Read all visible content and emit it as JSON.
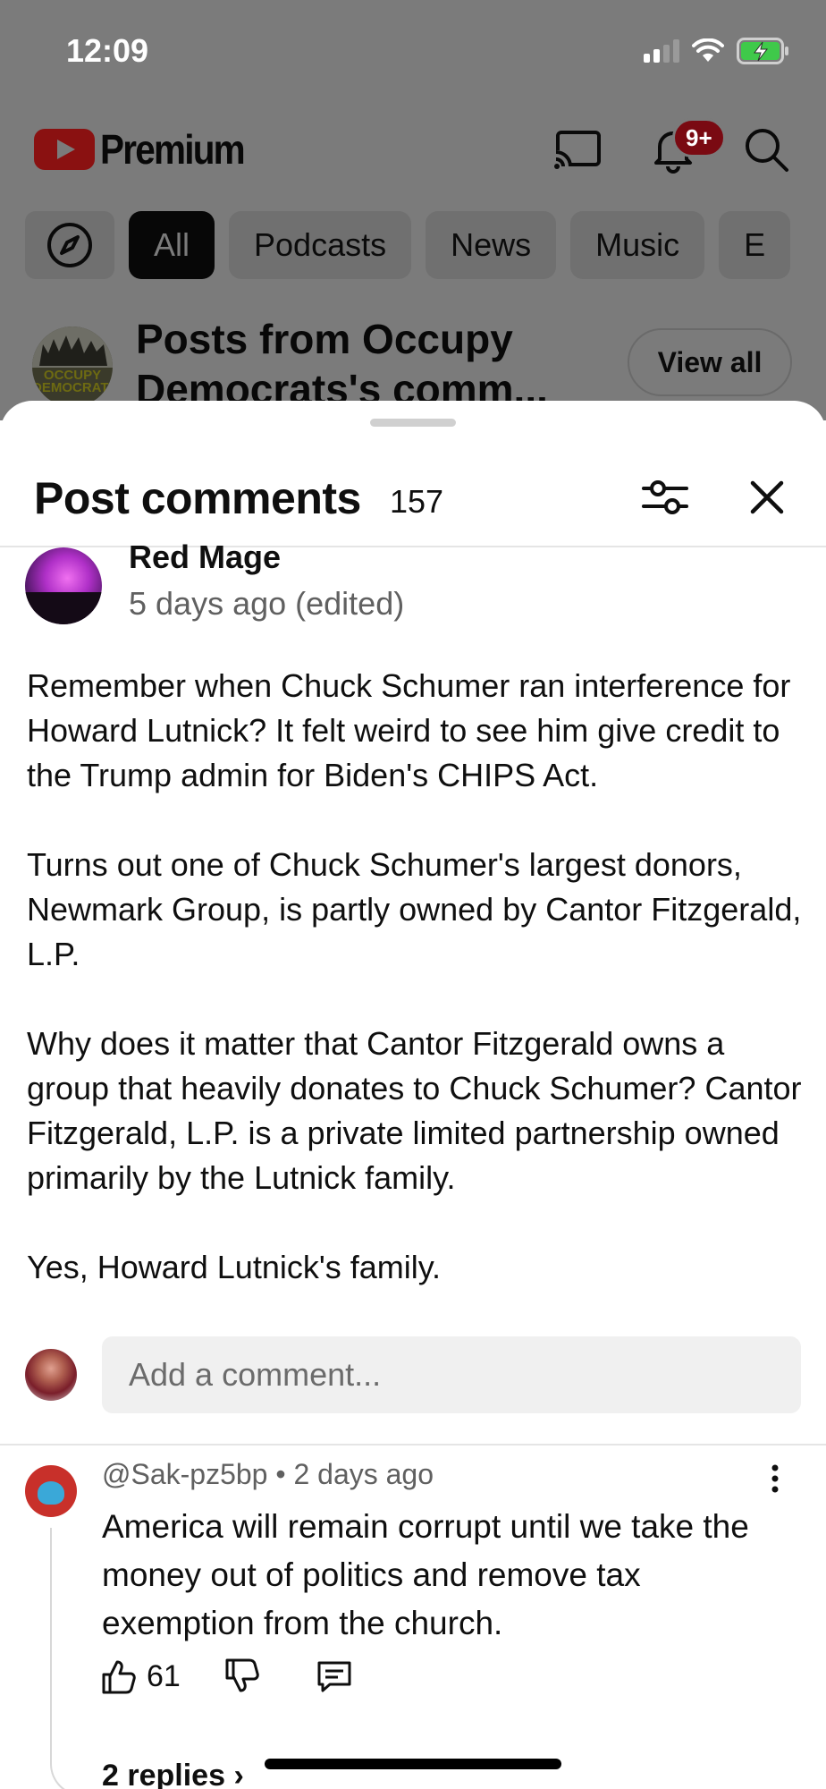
{
  "status_bar": {
    "time": "12:09",
    "icons": [
      "signal-icon",
      "wifi-icon",
      "battery-charging-icon"
    ]
  },
  "app_header": {
    "logo_text": "Premium",
    "notification_badge": "9+",
    "icons": [
      "cast-icon",
      "bell-icon",
      "search-icon"
    ]
  },
  "chips": {
    "explore_icon": "compass-icon",
    "items": [
      "All",
      "Podcasts",
      "News",
      "Music",
      "E"
    ],
    "selected": "All"
  },
  "posts_row": {
    "avatar_text": "OCCUPY DEMOCRATS",
    "title": "Posts from Occupy Democrats's comm...",
    "view_all_label": "View all"
  },
  "sheet": {
    "title": "Post comments",
    "count": "157",
    "icons": [
      "filter-icon",
      "close-icon"
    ]
  },
  "post": {
    "author": "Red Mage",
    "time": "5 days ago (edited)",
    "paragraphs": [
      "Remember when Chuck Schumer ran interference for Howard Lutnick? It felt weird to see him give credit to the Trump admin for Biden's CHIPS Act.",
      "Turns out one of Chuck Schumer's largest donors, Newmark Group, is partly owned by Cantor Fitzgerald, L.P.",
      "Why does it matter that Cantor Fitzgerald owns a group that heavily donates to Chuck Schumer? Cantor Fitzgerald, L.P. is a private limited partnership owned primarily by the Lutnick family.",
      "Yes, Howard Lutnick's family."
    ]
  },
  "add_comment": {
    "placeholder": "Add a comment..."
  },
  "comment": {
    "handle": "@Sak-pz5bp",
    "separator": "•",
    "time": "2 days ago",
    "text": "America will remain corrupt until we take the money out of politics and remove tax exemption from the church.",
    "likes": "61",
    "replies_label": "2 replies"
  }
}
